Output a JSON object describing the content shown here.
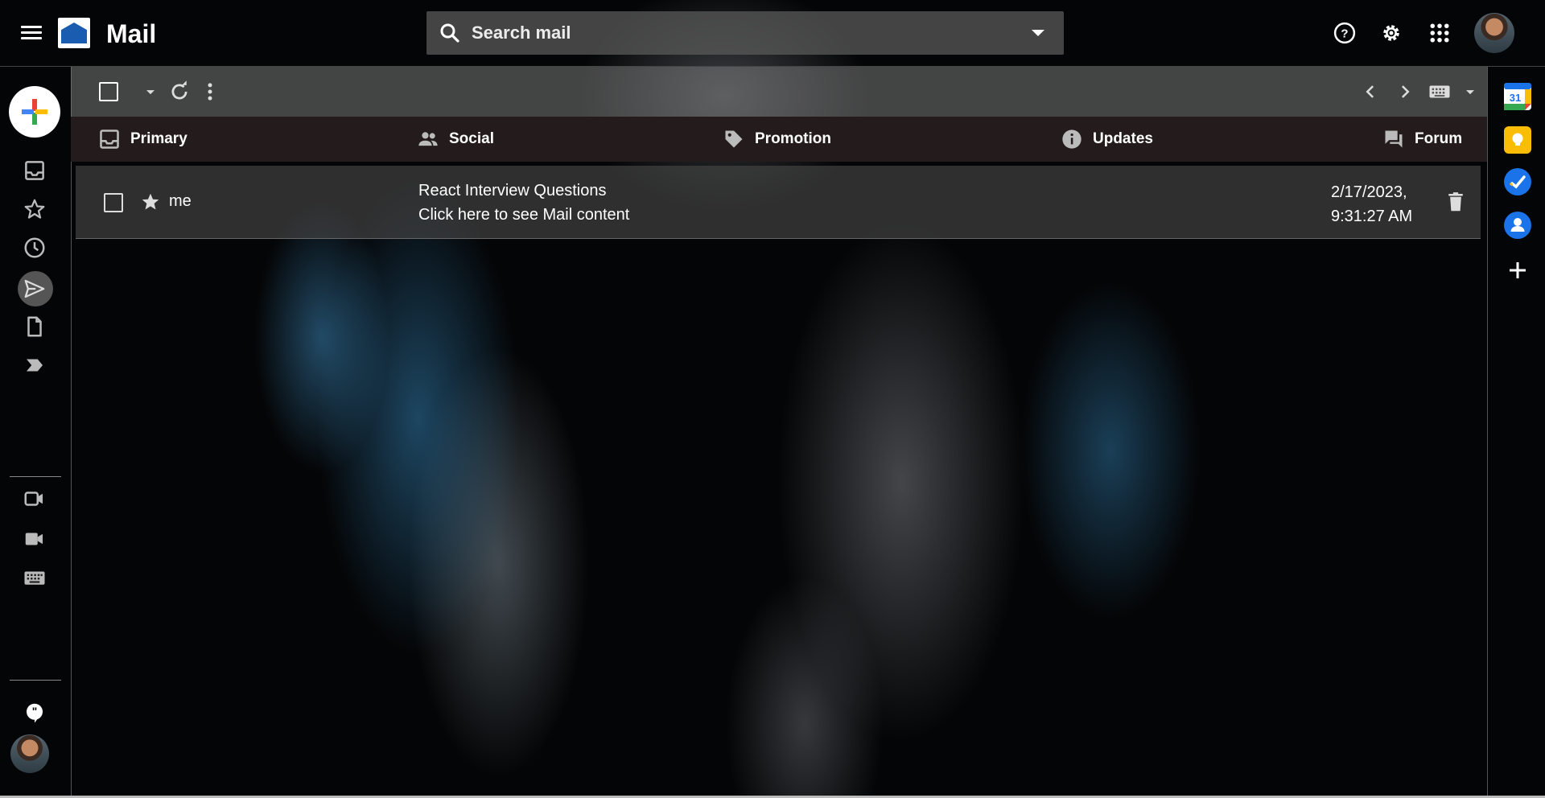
{
  "header": {
    "app_title": "Mail",
    "search_placeholder": "Search mail"
  },
  "leftrail": {
    "items": [
      {
        "name": "inbox",
        "icon": "inbox-icon"
      },
      {
        "name": "starred",
        "icon": "star-icon"
      },
      {
        "name": "snoozed",
        "icon": "clock-icon"
      },
      {
        "name": "sent",
        "icon": "send-icon",
        "active": true
      },
      {
        "name": "drafts",
        "icon": "document-icon"
      },
      {
        "name": "important",
        "icon": "label-important-icon"
      }
    ],
    "meet_items": [
      {
        "name": "new-meeting",
        "icon": "video-add-icon"
      },
      {
        "name": "join-meeting",
        "icon": "videocam-icon"
      },
      {
        "name": "keyboard",
        "icon": "keyboard-icon"
      }
    ]
  },
  "tabs": [
    {
      "label": "Primary",
      "icon": "inbox-icon"
    },
    {
      "label": "Social",
      "icon": "people-icon"
    },
    {
      "label": "Promotion",
      "icon": "tag-icon"
    },
    {
      "label": "Updates",
      "icon": "info-icon"
    },
    {
      "label": "Forum",
      "icon": "forum-icon"
    }
  ],
  "emails": [
    {
      "sender": "me",
      "subject": "React Interview Questions",
      "snippet": "Click here to see Mail content",
      "date_line1": "2/17/2023,",
      "date_line2": "9:31:27 AM"
    }
  ],
  "rightrail": {
    "calendar_day": "31"
  },
  "colors": {
    "tabs_bg": "#241c1c",
    "calendar_blue": "#1a73e8",
    "keep_yellow": "#fbbc04"
  }
}
